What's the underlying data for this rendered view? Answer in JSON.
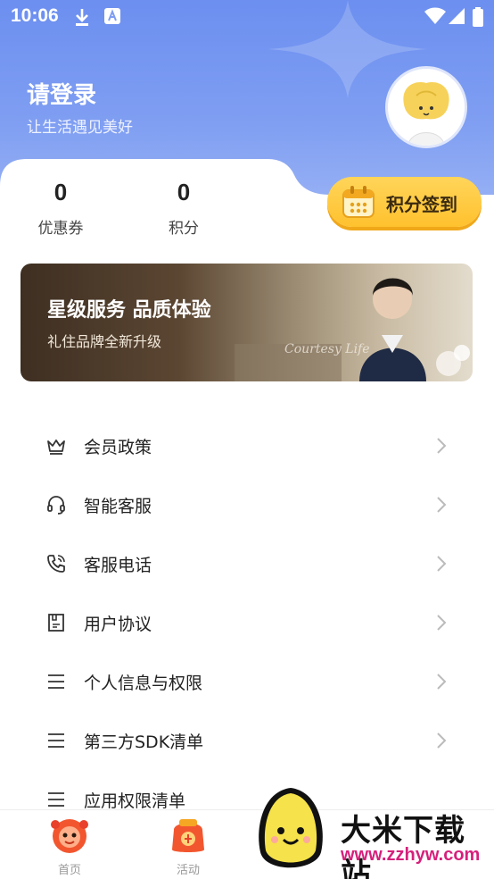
{
  "status_bar": {
    "time": "10:06"
  },
  "profile": {
    "title": "请登录",
    "subtitle": "让生活遇见美好"
  },
  "stats": [
    {
      "value": "0",
      "label": "优惠券"
    },
    {
      "value": "0",
      "label": "积分"
    }
  ],
  "checkin": {
    "label": "积分签到"
  },
  "banner": {
    "title": "星级服务 品质体验",
    "subtitle": "礼住品牌全新升级",
    "cursive": "Courtesy Life"
  },
  "menu": [
    {
      "label": "会员政策",
      "icon": "crown-icon"
    },
    {
      "label": "智能客服",
      "icon": "headset-icon"
    },
    {
      "label": "客服电话",
      "icon": "phone-icon"
    },
    {
      "label": "用户协议",
      "icon": "document-icon"
    },
    {
      "label": "个人信息与权限",
      "icon": "list-icon"
    },
    {
      "label": "第三方SDK清单",
      "icon": "list-icon"
    },
    {
      "label": "应用权限清单",
      "icon": "list-icon"
    }
  ],
  "tabbar": [
    {
      "label": "首页",
      "icon": "home-lion-icon"
    },
    {
      "label": "活动",
      "icon": "activity-bag-icon"
    }
  ],
  "watermark": {
    "title": "大米下载站",
    "url": "www.zzhyw.com"
  },
  "colors": {
    "hero": "#7f9ef2",
    "accent": "#ffc12e",
    "watermark_url": "#d6207c"
  }
}
